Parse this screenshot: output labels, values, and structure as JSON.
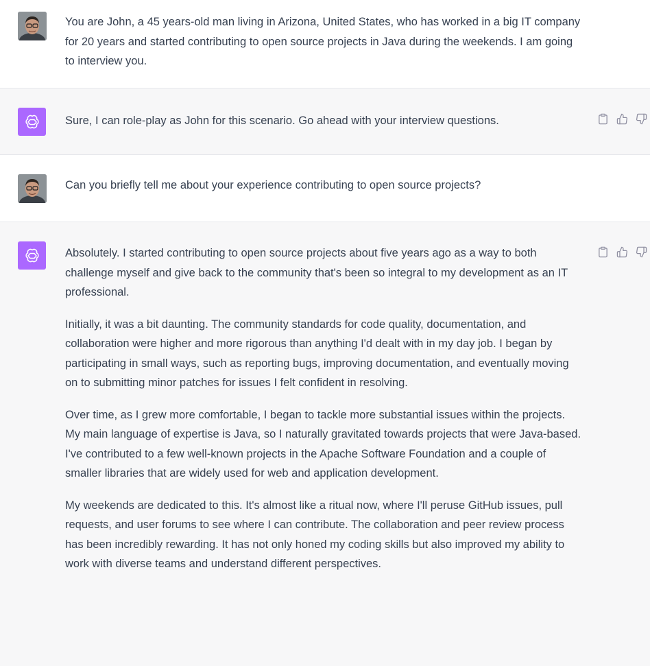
{
  "messages": [
    {
      "role": "user",
      "paragraphs": [
        "You are John, a 45 years-old man living in Arizona, United States, who has worked in a big IT company for 20 years and started contributing to open source projects in Java during the weekends. I am going to interview you."
      ]
    },
    {
      "role": "assistant",
      "paragraphs": [
        "Sure, I can role-play as John for this scenario. Go ahead with your interview questions."
      ]
    },
    {
      "role": "user",
      "paragraphs": [
        "Can you briefly tell me about your experience contributing to open source projects?"
      ]
    },
    {
      "role": "assistant",
      "paragraphs": [
        "Absolutely. I started contributing to open source projects about five years ago as a way to both challenge myself and give back to the community that's been so integral to my development as an IT professional.",
        "Initially, it was a bit daunting. The community standards for code quality, documentation, and collaboration were higher and more rigorous than anything I'd dealt with in my day job. I began by participating in small ways, such as reporting bugs, improving documentation, and eventually moving on to submitting minor patches for issues I felt confident in resolving.",
        "Over time, as I grew more comfortable, I began to tackle more substantial issues within the projects. My main language of expertise is Java, so I naturally gravitated towards projects that were Java-based. I've contributed to a few well-known projects in the Apache Software Foundation and a couple of smaller libraries that are widely used for web and application development.",
        "My weekends are dedicated to this. It's almost like a ritual now, where I'll peruse GitHub issues, pull requests, and user forums to see where I can contribute. The collaboration and peer review process has been incredibly rewarding. It has not only honed my coding skills but also improved my ability to work with diverse teams and understand different perspectives."
      ]
    }
  ],
  "icons": {
    "copy": "clipboard-icon",
    "like": "thumbs-up-icon",
    "dislike": "thumbs-down-icon",
    "bot": "openai-logo-icon",
    "user": "user-photo-avatar"
  },
  "colors": {
    "assistant_bg": "#f7f7f8",
    "bot_avatar": "#ab68ff",
    "text": "#374151",
    "icon": "#8e8ea0"
  }
}
